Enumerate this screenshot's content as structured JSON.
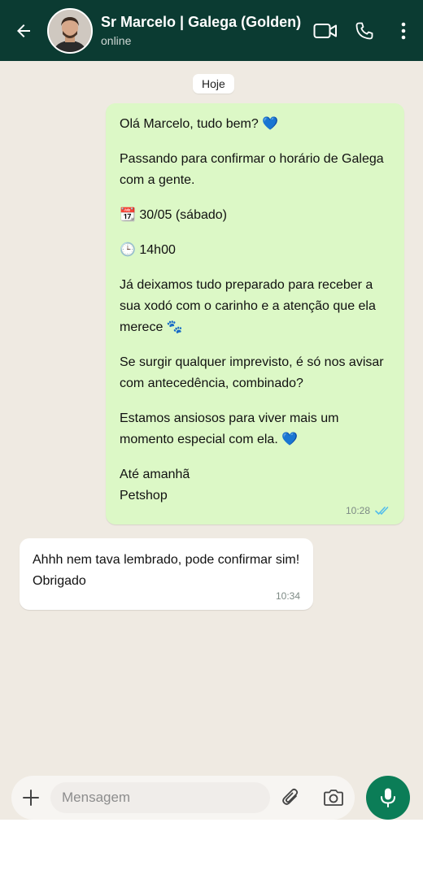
{
  "header": {
    "contact_name": "Sr Marcelo | Galega (Golden)",
    "status": "online",
    "icons": [
      "back-arrow-icon",
      "video-call-icon",
      "phone-icon",
      "more-vert-icon"
    ],
    "colors": {
      "bar": "#0b3b32",
      "accent": "#0b7d57"
    }
  },
  "chat": {
    "date_chip": "Hoje",
    "messages": [
      {
        "direction": "outgoing",
        "paragraphs": [
          [
            "Olá Marcelo, tudo bem? 💙"
          ],
          [
            "Passando para confirmar o horário de Galega",
            "com a gente."
          ],
          [
            "📆 30/05 (sábado)"
          ],
          [
            "🕒 14h00"
          ],
          [
            "Já deixamos tudo preparado para receber a",
            "sua xodó com o carinho e a atenção que ela",
            "merece 🐾"
          ],
          [
            "Se surgir qualquer imprevisto, é só nos avisar",
            "com antecedência, combinado?"
          ],
          [
            "Estamos ansiosos para viver mais um",
            "momento especial com ela. 💙"
          ],
          [
            "Até amanhã",
            "Petshop"
          ]
        ],
        "time": "10:28",
        "read": true
      },
      {
        "direction": "incoming",
        "paragraphs": [
          [
            "Ahhh nem tava lembrado, pode confirmar sim!",
            "Obrigado"
          ]
        ],
        "time": "10:34"
      }
    ]
  },
  "composer": {
    "placeholder": "Mensagem",
    "icons": [
      "plus-icon",
      "attach-icon",
      "camera-icon",
      "mic-icon"
    ]
  }
}
